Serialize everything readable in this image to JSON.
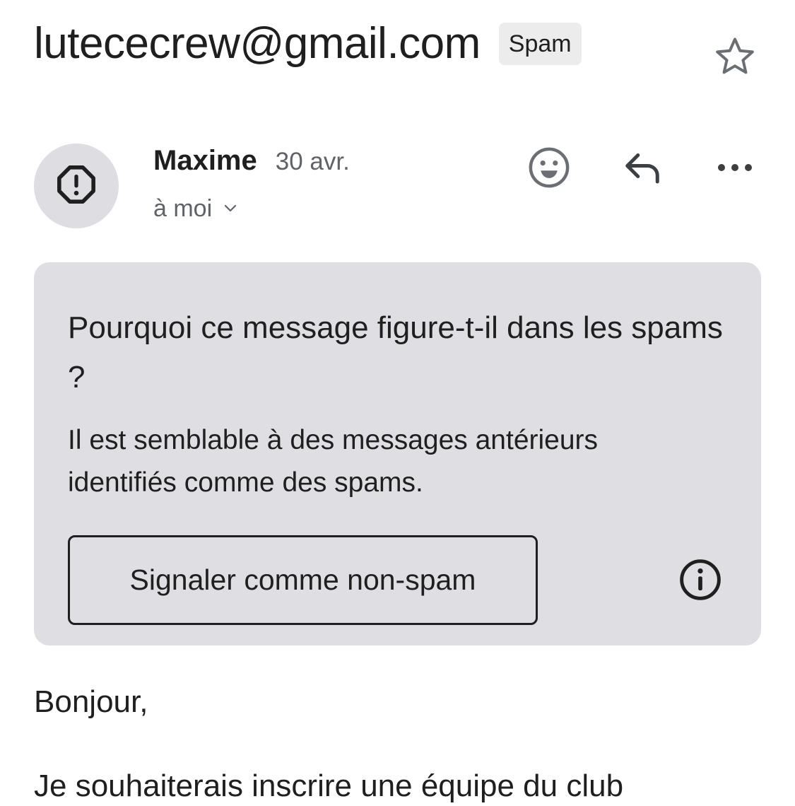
{
  "header": {
    "subject": "lutececrew@gmail.com",
    "label": "Spam"
  },
  "message": {
    "sender": "Maxime",
    "date": "30 avr.",
    "recipient": "à moi"
  },
  "spam_card": {
    "title": "Pourquoi ce message figure-t-il dans les spams ?",
    "text": "Il est semblable à des messages antérieurs identifiés comme des spams.",
    "button_label": "Signaler comme non-spam"
  },
  "body": {
    "greeting": "Bonjour,",
    "paragraph": "Je souhaiterais inscrire une équipe du club"
  },
  "icons": {
    "star": "star-outline-icon",
    "avatar": "spam-warning-icon",
    "emoji": "emoji-reaction-icon",
    "reply": "reply-icon",
    "more": "more-horizontal-icon",
    "recipient_toggle": "chevron-down-icon",
    "info": "info-icon"
  },
  "colors": {
    "card_background": "#dfdfe3",
    "avatar_background": "#dddde2",
    "label_chip": "#ececec",
    "secondary_text": "#5f6368"
  }
}
